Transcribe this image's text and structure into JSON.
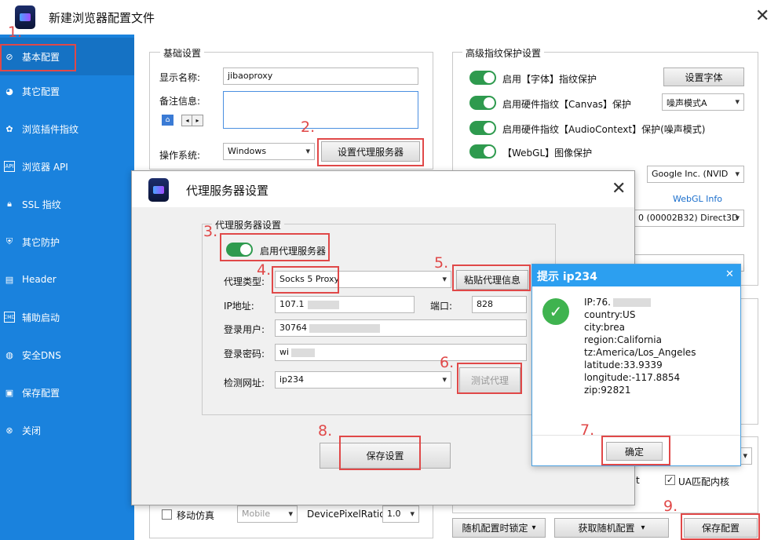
{
  "window": {
    "title": "新建浏览器配置文件"
  },
  "sidebar": {
    "items": [
      {
        "label": "基本配置",
        "icon": "compass-icon"
      },
      {
        "label": "其它配置",
        "icon": "chrome-icon"
      },
      {
        "label": "浏览插件指纹",
        "icon": "plugin-icon"
      },
      {
        "label": "浏览器 API",
        "icon": "api-icon"
      },
      {
        "label": "SSL 指纹",
        "icon": "lock-icon"
      },
      {
        "label": "其它防护",
        "icon": "shield-icon"
      },
      {
        "label": "Header",
        "icon": "header-icon"
      },
      {
        "label": "辅助启动",
        "icon": "cmd-icon"
      },
      {
        "label": "安全DNS",
        "icon": "globe-icon"
      },
      {
        "label": "保存配置",
        "icon": "save-icon"
      },
      {
        "label": "关闭",
        "icon": "close-circle-icon"
      }
    ]
  },
  "basic": {
    "title": "基础设置",
    "display_name_label": "显示名称:",
    "display_name_value": "jibaoproxy",
    "note_label": "备注信息:",
    "os_label": "操作系统:",
    "os_value": "Windows",
    "proxy_button": "设置代理服务器"
  },
  "advanced": {
    "title": "高级指纹保护设置",
    "font_toggle": "启用【字体】指纹保护",
    "font_button": "设置字体",
    "canvas_toggle": "启用硬件指纹【Canvas】保护",
    "canvas_mode": "噪声模式A",
    "audio_toggle": "启用硬件指纹【AudioContext】保护(噪声模式)",
    "webgl_toggle": "【WebGL】图像保护",
    "webgl_vendor": "Google Inc. (NVID",
    "webgl_info": "WebGL Info",
    "webgl_renderer": "0 (00002B32) Direct3D"
  },
  "bottom": {
    "mobile_label": "移动仿真",
    "mobile_value": "Mobile",
    "dpr_label": "DevicePixelRatio:",
    "dpr_value": "1.0",
    "ua_label": "UA匹配内核",
    "t_fragment": "t",
    "random_lock": "随机配置时锁定",
    "random_get": "获取随机配置",
    "save_config": "保存配置"
  },
  "proxy_dialog": {
    "title": "代理服务器设置",
    "group_title": "代理服务器设置",
    "enable_label": "启用代理服务器",
    "type_label": "代理类型:",
    "type_value": "Socks 5 Proxy",
    "paste_button": "粘贴代理信息",
    "ip_label": "IP地址:",
    "ip_value": "107.1",
    "port_label": "端口:",
    "port_value": "828",
    "user_label": "登录用户:",
    "user_value": "30764",
    "pass_label": "登录密码:",
    "pass_value": "wi",
    "check_label": "检测网址:",
    "check_value": "ip234",
    "test_button": "测试代理",
    "save_button": "保存设置"
  },
  "tip": {
    "title": "提示 ip234",
    "lines": [
      "IP:76.",
      "country:US",
      "city:brea",
      "region:California",
      "tz:America/Los_Angeles",
      "latitude:33.9339",
      "longitude:-117.8854",
      "zip:92821"
    ],
    "ok_button": "确定"
  },
  "steps": [
    "1.",
    "2.",
    "3.",
    "4.",
    "5.",
    "6.",
    "7.",
    "8.",
    "9."
  ],
  "colors": {
    "sidebar": "#1a82dd",
    "toggle_on": "#2e9a4e",
    "highlight": "#e04848",
    "tip_header": "#2c9ff0"
  }
}
